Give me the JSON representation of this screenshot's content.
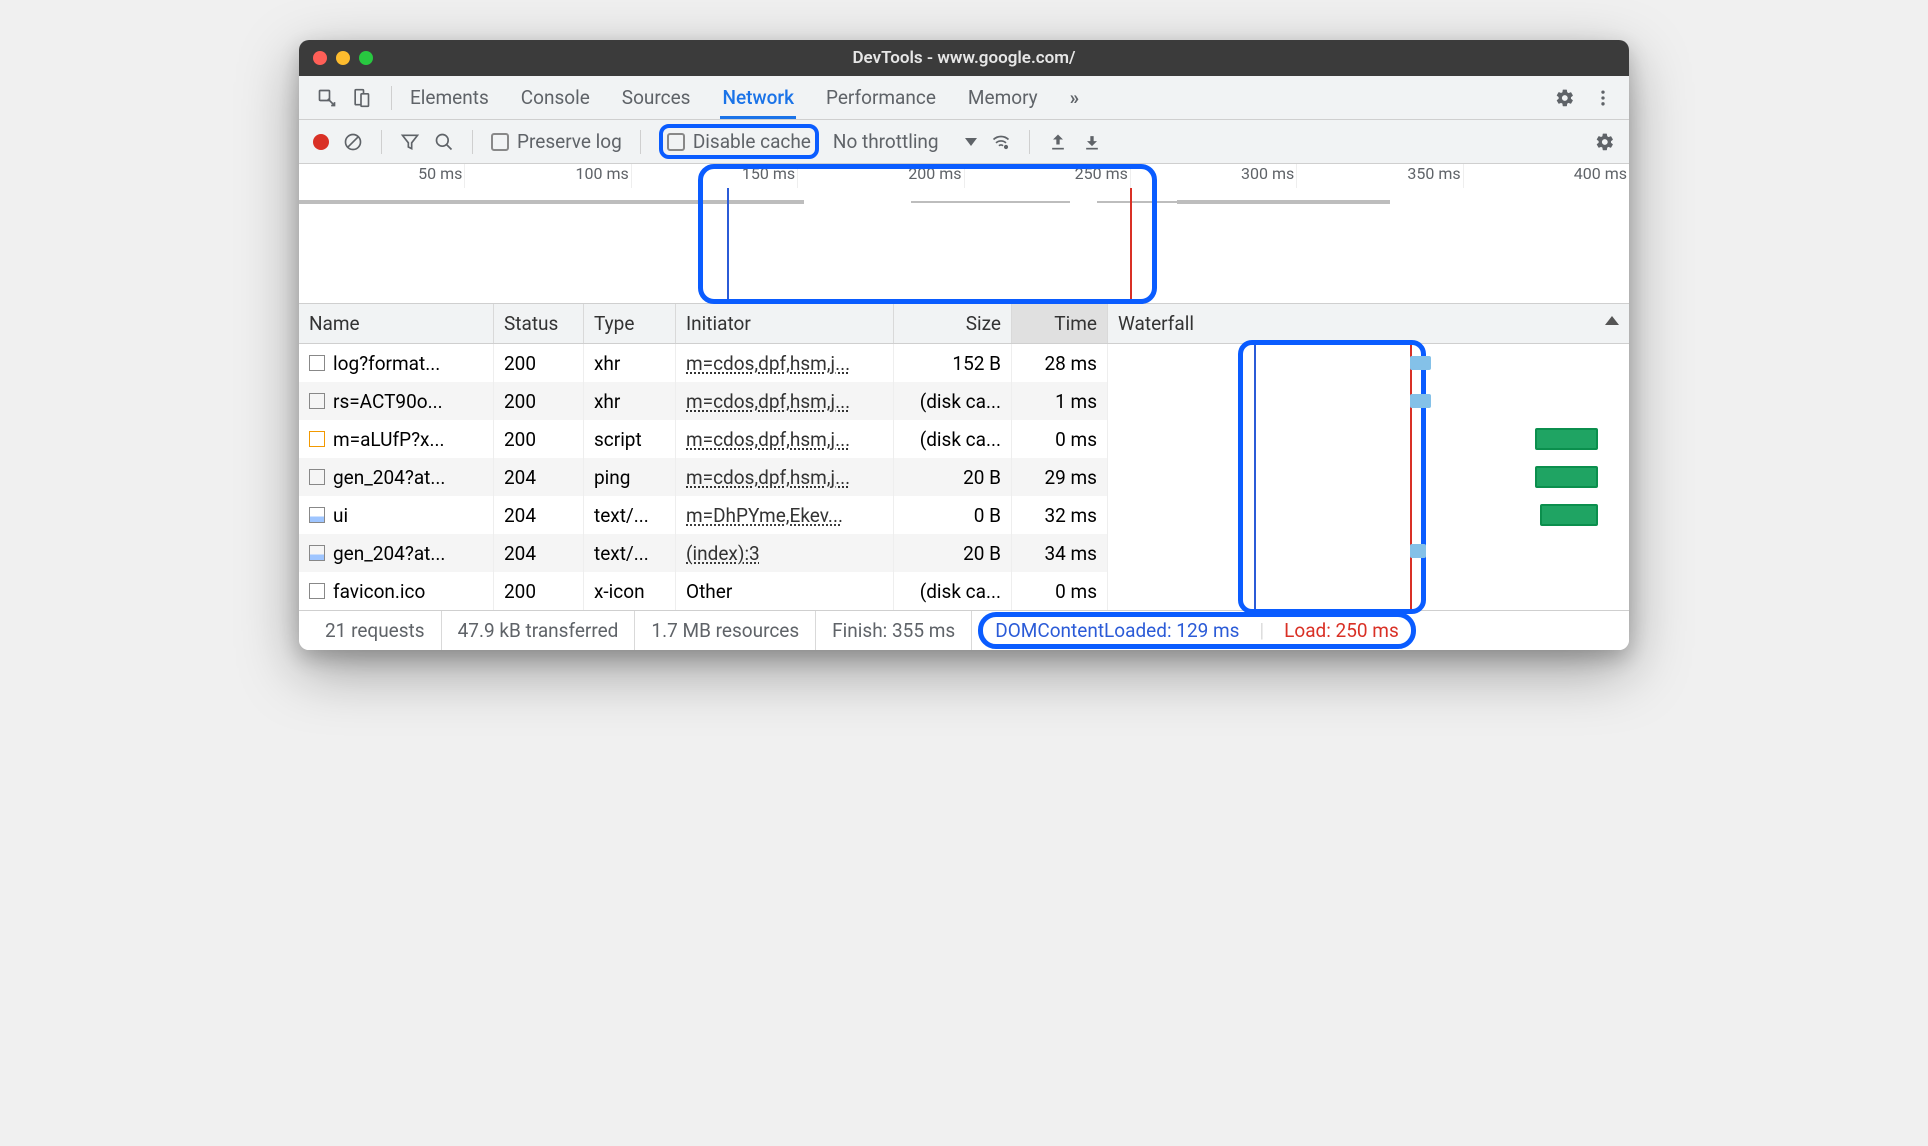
{
  "window": {
    "title": "DevTools - www.google.com/"
  },
  "tabs": {
    "items": [
      "Elements",
      "Console",
      "Sources",
      "Network",
      "Performance",
      "Memory"
    ],
    "active": "Network",
    "more": "»"
  },
  "toolbar": {
    "preserve_log": "Preserve log",
    "disable_cache": "Disable cache",
    "throttling": "No throttling"
  },
  "overview": {
    "ticks": [
      "50 ms",
      "100 ms",
      "150 ms",
      "200 ms",
      "250 ms",
      "300 ms",
      "350 ms",
      "400 ms"
    ]
  },
  "columns": {
    "name": "Name",
    "status": "Status",
    "type": "Type",
    "initiator": "Initiator",
    "size": "Size",
    "time": "Time",
    "waterfall": "Waterfall"
  },
  "rows": [
    {
      "icon": "blank",
      "name": "log?format...",
      "status": "200",
      "type": "xhr",
      "initiator": "m=cdos,dpf,hsm,j...",
      "size": "152 B",
      "time": "28 ms"
    },
    {
      "icon": "blank",
      "name": "rs=ACT90o...",
      "status": "200",
      "type": "xhr",
      "initiator": "m=cdos,dpf,hsm,j...",
      "size": "(disk ca...",
      "time": "1 ms"
    },
    {
      "icon": "orange",
      "name": "m=aLUfP?x...",
      "status": "200",
      "type": "script",
      "initiator": "m=cdos,dpf,hsm,j...",
      "size": "(disk ca...",
      "time": "0 ms"
    },
    {
      "icon": "blank",
      "name": "gen_204?at...",
      "status": "204",
      "type": "ping",
      "initiator": "m=cdos,dpf,hsm,j...",
      "size": "20 B",
      "time": "29 ms"
    },
    {
      "icon": "img",
      "name": "ui",
      "status": "204",
      "type": "text/...",
      "initiator": "m=DhPYme,Ekev...",
      "size": "0 B",
      "time": "32 ms"
    },
    {
      "icon": "img",
      "name": "gen_204?at...",
      "status": "204",
      "type": "text/...",
      "initiator": "(index):3",
      "size": "20 B",
      "time": "34 ms"
    },
    {
      "icon": "blank",
      "name": "favicon.ico",
      "status": "200",
      "type": "x-icon",
      "initiator": "Other",
      "initiator_plain": true,
      "size": "(disk ca...",
      "time": "0 ms"
    }
  ],
  "status": {
    "requests": "21 requests",
    "transferred": "47.9 kB transferred",
    "resources": "1.7 MB resources",
    "finish": "Finish: 355 ms",
    "dcl": "DOMContentLoaded: 129 ms",
    "load": "Load: 250 ms"
  }
}
